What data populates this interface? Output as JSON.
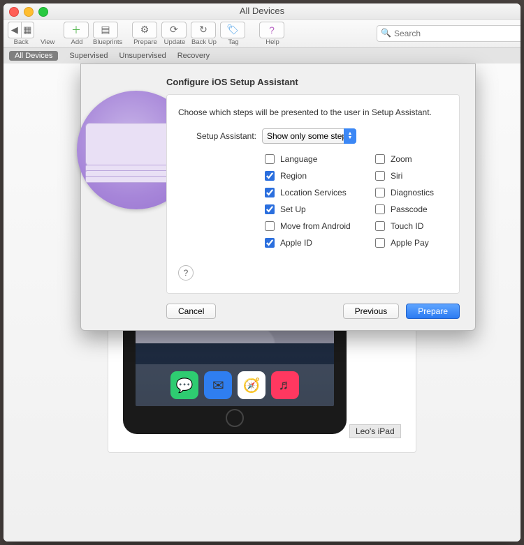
{
  "window_title": "All Devices",
  "toolbar": {
    "back": "Back",
    "view": "View",
    "add": "Add",
    "blueprints": "Blueprints",
    "prepare": "Prepare",
    "update": "Update",
    "backup": "Back Up",
    "tag": "Tag",
    "help": "Help",
    "search_placeholder": "Search"
  },
  "scope": {
    "all": "All Devices",
    "supervised": "Supervised",
    "unsupervised": "Unsupervised",
    "recovery": "Recovery"
  },
  "device_name": "Leo's iPad",
  "sheet": {
    "title": "Configure iOS Setup Assistant",
    "lead": "Choose which steps will be presented to the user in Setup Assistant.",
    "field_label": "Setup Assistant:",
    "select_value": "Show only some steps",
    "options": {
      "language": {
        "label": "Language",
        "checked": false
      },
      "region": {
        "label": "Region",
        "checked": true
      },
      "location": {
        "label": "Location Services",
        "checked": true
      },
      "setup": {
        "label": "Set Up",
        "checked": true
      },
      "move": {
        "label": "Move from Android",
        "checked": false
      },
      "appleid": {
        "label": "Apple ID",
        "checked": true
      },
      "zoom": {
        "label": "Zoom",
        "checked": false
      },
      "siri": {
        "label": "Siri",
        "checked": false
      },
      "diagnostics": {
        "label": "Diagnostics",
        "checked": false
      },
      "passcode": {
        "label": "Passcode",
        "checked": false
      },
      "touchid": {
        "label": "Touch ID",
        "checked": false
      },
      "applepay": {
        "label": "Apple Pay",
        "checked": false
      }
    },
    "buttons": {
      "cancel": "Cancel",
      "previous": "Previous",
      "prepare": "Prepare"
    },
    "help": "?"
  }
}
